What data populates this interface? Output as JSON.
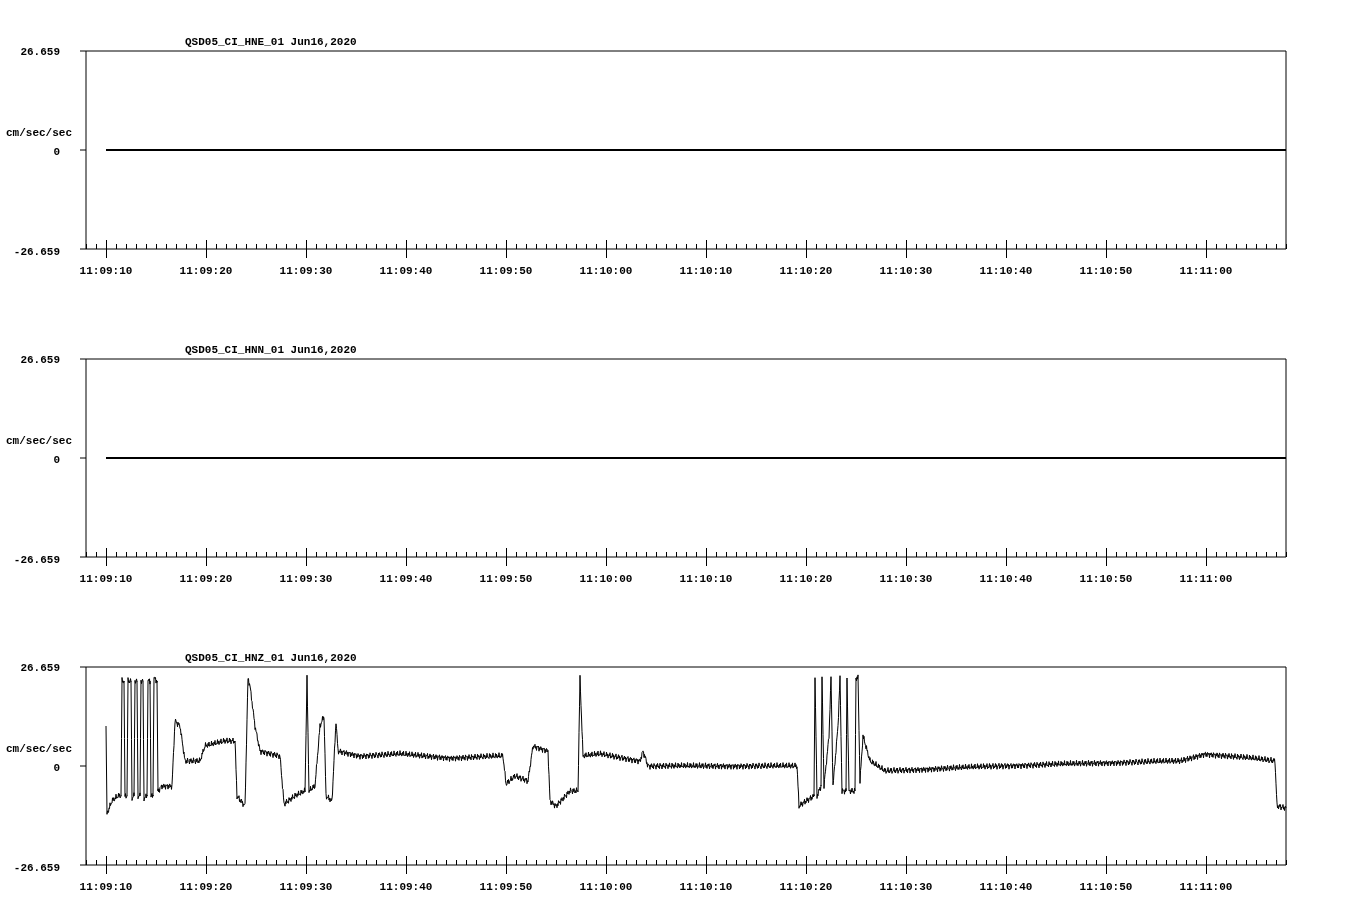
{
  "panels": [
    {
      "title": "QSD05_CI_HNE_01  Jun16,2020",
      "y_max": "26.659",
      "y_zero": "0",
      "y_min": "-26.659",
      "y_unit": "cm/sec/sec",
      "trace": {
        "kind": "flat"
      },
      "x_ticks": [
        "11:09:10",
        "11:09:20",
        "11:09:30",
        "11:09:40",
        "11:09:50",
        "11:10:00",
        "11:10:10",
        "11:10:20",
        "11:10:30",
        "11:10:40",
        "11:10:50",
        "11:11:00"
      ]
    },
    {
      "title": "QSD05_CI_HNN_01  Jun16,2020",
      "y_max": "26.659",
      "y_zero": "0",
      "y_min": "-26.659",
      "y_unit": "cm/sec/sec",
      "trace": {
        "kind": "flat"
      },
      "x_ticks": [
        "11:09:10",
        "11:09:20",
        "11:09:30",
        "11:09:40",
        "11:09:50",
        "11:10:00",
        "11:10:10",
        "11:10:20",
        "11:10:30",
        "11:10:40",
        "11:10:50",
        "11:11:00"
      ]
    },
    {
      "title": "QSD05_CI_HNZ_01  Jun16,2020",
      "y_max": "26.659",
      "y_zero": "0",
      "y_min": "-26.659",
      "y_unit": "cm/sec/sec",
      "trace": {
        "kind": "wave"
      },
      "x_ticks": [
        "11:09:10",
        "11:09:20",
        "11:09:30",
        "11:09:40",
        "11:09:50",
        "11:10:00",
        "11:10:10",
        "11:10:20",
        "11:10:30",
        "11:10:40",
        "11:10:50",
        "11:11:00"
      ]
    }
  ]
}
